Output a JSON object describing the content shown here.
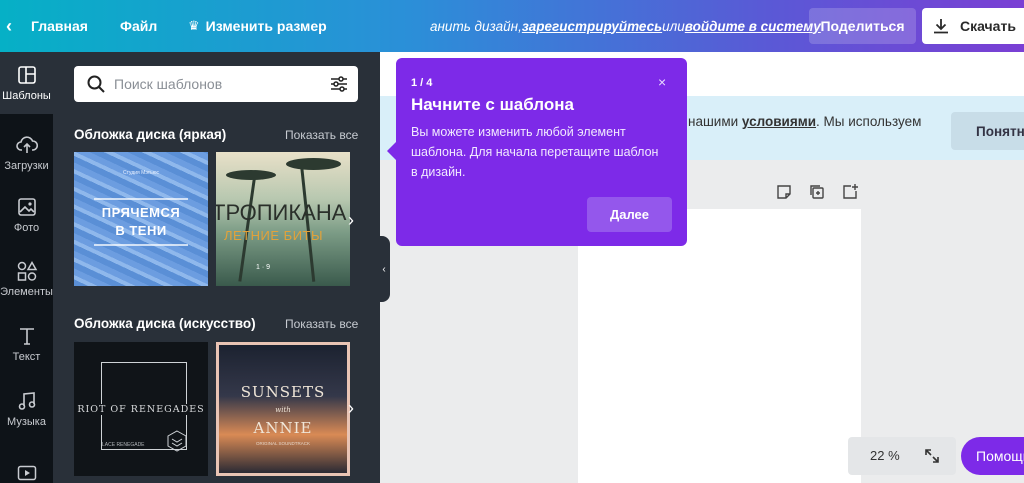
{
  "topbar": {
    "home": "Главная",
    "file": "Файл",
    "resize": "Изменить размер",
    "signup_prefix": "анить дизайн, ",
    "signup_link": "зарегистрируйтесь",
    "signup_or": " или ",
    "login_link": "войдите в систему",
    "share": "Поделиться",
    "download": "Скачать"
  },
  "rail": {
    "items": [
      {
        "label": "Шаблоны",
        "icon": "templates-icon"
      },
      {
        "label": "Загрузки",
        "icon": "upload-cloud-icon"
      },
      {
        "label": "Фото",
        "icon": "photo-icon"
      },
      {
        "label": "Элементы",
        "icon": "elements-icon"
      },
      {
        "label": "Текст",
        "icon": "text-icon"
      },
      {
        "label": "Музыка",
        "icon": "music-icon"
      },
      {
        "label": "",
        "icon": "video-icon"
      }
    ]
  },
  "panel": {
    "search_placeholder": "Поиск шаблонов",
    "sections": [
      {
        "title": "Обложка диска (яркая)",
        "show_all": "Показать все",
        "thumbs": [
          {
            "small": "Студия Мэтьюс",
            "title1": "ПРЯЧЕМСЯ",
            "title2": "В ТЕНИ"
          },
          {
            "title": "ТРОПИКАНА",
            "subtitle": "ЛЕТНИЕ БИТЫ",
            "num": "1 · 9"
          }
        ]
      },
      {
        "title": "Обложка диска (искусство)",
        "show_all": "Показать все",
        "thumbs": [
          {
            "title": "RIOT OF RENEGADES",
            "author": "LACE RENEGADE"
          },
          {
            "title1": "SUNSETS",
            "with": "with",
            "title2": "ANNIE",
            "small": "ORIGINAL SOUNDTRACK"
          }
        ]
      }
    ]
  },
  "cookie": {
    "text_prefix": "нашими ",
    "link": "условиями",
    "text_suffix": ". Мы используем",
    "button": "Понятно"
  },
  "zoom": {
    "value": "22 %"
  },
  "help": {
    "label": "Помощь"
  },
  "tour": {
    "step": "1 / 4",
    "close": "×",
    "title": "Начните с шаблона",
    "body": "Вы можете изменить любой элемент шаблона. Для начала перетащите шаблон в дизайн.",
    "next": "Далее"
  },
  "colors": {
    "accent": "#7d2ae8",
    "rail_bg": "#0e1318",
    "panel_bg": "#293039"
  }
}
